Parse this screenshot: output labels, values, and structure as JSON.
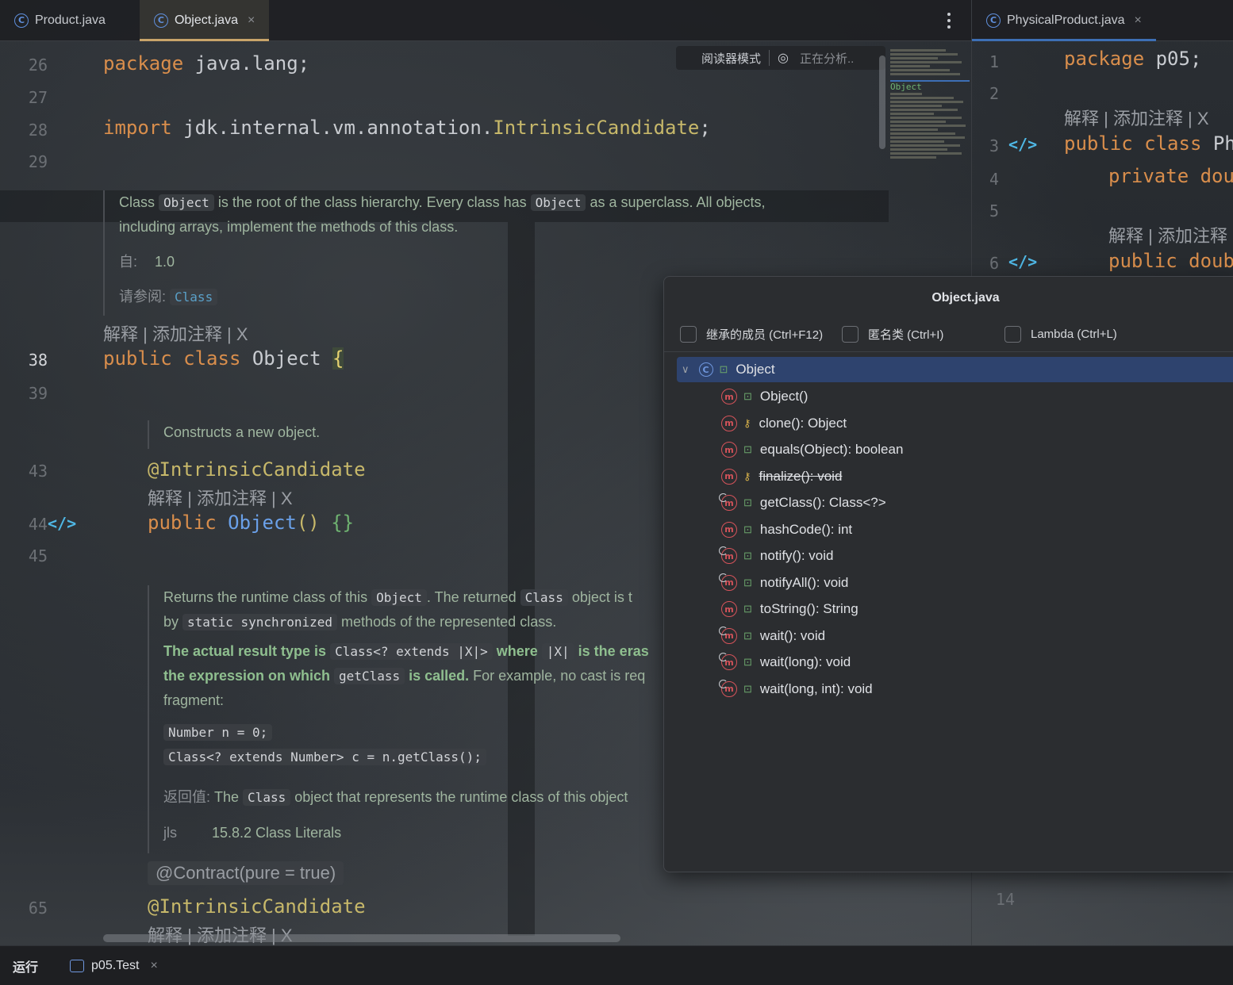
{
  "tabs_left": [
    {
      "label": "Product.java",
      "icon": "class-icon",
      "active": false
    },
    {
      "label": "Object.java",
      "icon": "class-icon",
      "active": true,
      "close": "×"
    }
  ],
  "tabs_right": [
    {
      "label": "PhysicalProduct.java",
      "icon": "class-icon",
      "close": "×"
    }
  ],
  "reader_bar": {
    "reader_mode": "阅读器模式",
    "analyzing": "正在分析.."
  },
  "editor": {
    "line_numbers": {
      "l26": "26",
      "l27": "27",
      "l28": "28",
      "l29": "29",
      "l38": "38",
      "l39": "39",
      "l43": "43",
      "l44": "44",
      "l45": "45",
      "l65": "65"
    },
    "package_kw": "package",
    "package_name": " java.lang;",
    "import_kw": "import",
    "import_path": " jdk.internal.vm.annotation.",
    "import_class": "IntrinsicCandidate",
    "import_end": ";",
    "class_doc": {
      "t1": "Class ",
      "c1": "Object",
      "t2": " is the root of the class hierarchy. Every class has ",
      "c2": "Object",
      "t3": " as a superclass. All objects,",
      "t4": "including arrays, implement the methods of this class.",
      "since_label": "自:",
      "since_value": "1.0",
      "see_label": "请参阅:",
      "see_value": "Class"
    },
    "inlay_hint": "解释 | 添加注释 | X",
    "class_decl": {
      "public": "public",
      "class": " class",
      "name": " Object ",
      "brace": "{"
    },
    "ctor_doc": "Constructs a new object.",
    "annotation": "@IntrinsicCandidate",
    "ctor_decl": {
      "public": "public",
      "name": " Object",
      "parens": "()",
      "body": " {}"
    },
    "getclass_doc": {
      "a1": "Returns the runtime class of this ",
      "a1c": "Object",
      "a2": ". The returned ",
      "a2c": "Class",
      "a3": " object is t",
      "b1": "by ",
      "b1c": "static synchronized",
      "b2": " methods of the represented class.",
      "c1": "The actual result type is ",
      "c1c": "Class<? extends |X|>",
      "c2": " where ",
      "c2c": "|X|",
      "c3": " is the eras",
      "d1": "the expression on which ",
      "d1c": "getClass",
      "d2": " is called.",
      "d3": " For example, no cast is req",
      "e1": "fragment:",
      "code1": "Number n = 0;",
      "code2": "Class<? extends Number> c = n.getClass();",
      "ret_label": "返回值:",
      "ret_t1": " The ",
      "ret_c": "Class",
      "ret_t2": " object that represents the runtime class of this object",
      "jls_label": "jls",
      "jls_value": "15.8.2 Class Literals"
    },
    "contract": "@Contract(pure = true)",
    "annotation2": "@IntrinsicCandidate"
  },
  "right_editor": {
    "line_numbers": {
      "l1": "1",
      "l2": "2",
      "l3": "3",
      "l4": "4",
      "l5": "5",
      "l6": "6",
      "l14": "14"
    },
    "line1_kw": "package",
    "line1_rest": " p05;",
    "inlay": "解释 | 添加注释 | X",
    "line3_public": "public",
    "line3_class": " class",
    "line3_rest": " Phy",
    "line4_private": "private",
    "line4_rest": " dou",
    "inlay2": "解释 | 添加注释",
    "line6_public": "public",
    "line6_rest": " doub"
  },
  "minimap_label": "Object",
  "popup": {
    "title": "Object.java",
    "filters": [
      {
        "label": "继承的成员 (Ctrl+F12)"
      },
      {
        "label": "匿名类 (Ctrl+I)"
      },
      {
        "label": "Lambda (Ctrl+L)"
      }
    ],
    "root": "Object",
    "members": [
      {
        "label": "Object()",
        "visibility": "public",
        "overridable": false,
        "deprecated": false
      },
      {
        "label": "clone(): Object",
        "visibility": "protected",
        "overridable": false,
        "deprecated": false
      },
      {
        "label": "equals(Object): boolean",
        "visibility": "public",
        "overridable": false,
        "deprecated": false
      },
      {
        "label": "finalize(): void",
        "visibility": "protected",
        "overridable": false,
        "deprecated": true
      },
      {
        "label": "getClass(): Class<?>",
        "visibility": "public",
        "overridable": true,
        "deprecated": false
      },
      {
        "label": "hashCode(): int",
        "visibility": "public",
        "overridable": false,
        "deprecated": false
      },
      {
        "label": "notify(): void",
        "visibility": "public",
        "overridable": true,
        "deprecated": false
      },
      {
        "label": "notifyAll(): void",
        "visibility": "public",
        "overridable": true,
        "deprecated": false
      },
      {
        "label": "toString(): String",
        "visibility": "public",
        "overridable": false,
        "deprecated": false
      },
      {
        "label": "wait(): void",
        "visibility": "public",
        "overridable": true,
        "deprecated": false
      },
      {
        "label": "wait(long): void",
        "visibility": "public",
        "overridable": true,
        "deprecated": false
      },
      {
        "label": "wait(long, int): void",
        "visibility": "public",
        "overridable": true,
        "deprecated": false
      }
    ]
  },
  "bottom": {
    "run_label": "运行",
    "run_tab": "p05.Test",
    "close": "×"
  },
  "colors": {
    "keyword": "#d98e4c",
    "annotation": "#c7b86a",
    "method": "#6aa0e8",
    "selection": "#2e436e",
    "method_icon": "#d6535a"
  }
}
